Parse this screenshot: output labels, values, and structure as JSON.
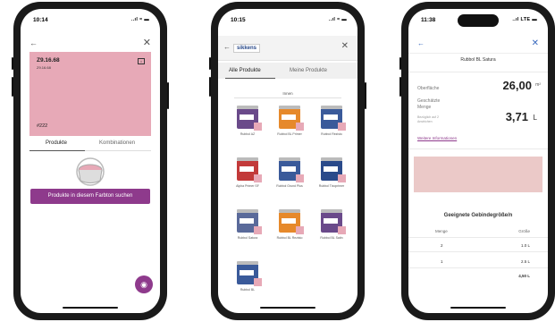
{
  "phone1": {
    "time": "10:14",
    "status_icons": "..ıl ≈ ▬",
    "color_code": "Z9.16.68",
    "color_sub": "Z9.16.68",
    "color_number": "#222",
    "swatch_color": "#e7a9b7",
    "tab_products": "Produkte",
    "tab_combinations": "Kombinationen",
    "search_button": "Produkte in diesem Farbton suchen",
    "accent": "#8e3a8c"
  },
  "phone2": {
    "time": "10:15",
    "status_icons": "..ıl ≈ ▬",
    "logo": "sikkens",
    "tab_all": "Alle Produkte",
    "tab_mine": "Meine Produkte",
    "section": "Innen",
    "products": [
      {
        "name": "Rubbol AZ",
        "color": "#6a4a8a"
      },
      {
        "name": "Rubbol BL Primer",
        "color": "#e6892b"
      },
      {
        "name": "Rubbol Rezisto",
        "color": "#3a5a9a"
      },
      {
        "name": "Alpha Primer SF",
        "color": "#c23a3a"
      },
      {
        "name": "Rubbol Grund Plus",
        "color": "#3a5a9a"
      },
      {
        "name": "Rubbol Tixoprimer",
        "color": "#2a4a8a"
      },
      {
        "name": "Rubbol Satura",
        "color": "#5a6a9a"
      },
      {
        "name": "Rubbol BL Rezisto",
        "color": "#e6892b"
      },
      {
        "name": "Rubbol BL Satin",
        "color": "#6a4a8a"
      },
      {
        "name": "Rubbol BL",
        "color": "#3a5a9a"
      }
    ]
  },
  "phone3": {
    "time": "11:38",
    "status_icons": "..ıl LTE ▬",
    "title": "Rubbol BL Satura",
    "surface_label": "Oberfläche",
    "surface_value": "26,00",
    "surface_unit": "m²",
    "qty_label": "Geschätzte Menge",
    "qty_sub": "Bezüglich auf 2 Anstrichen",
    "qty_value": "3,71",
    "qty_unit": "L",
    "more_info": "Weitere Informationen",
    "band_color": "#ebc9c8",
    "section_title": "Geeignete Gebindegröße/n",
    "col_qty": "Menge",
    "col_size": "Größe",
    "rows": [
      {
        "qty": "2",
        "size": "1.0 L"
      },
      {
        "qty": "1",
        "size": "2.5 L"
      }
    ],
    "total": "4,50 L"
  }
}
